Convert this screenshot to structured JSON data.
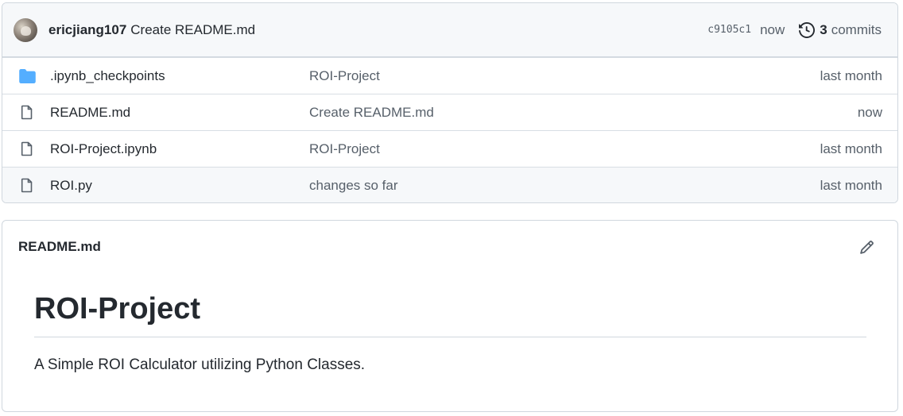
{
  "commit": {
    "author": "ericjiang107",
    "message": "Create README.md",
    "sha": "c9105c1",
    "time": "now",
    "commit_count": "3",
    "commit_label": "commits"
  },
  "files": [
    {
      "type": "folder",
      "icon": "folder-icon",
      "name": ".ipynb_checkpoints",
      "message": "ROI-Project",
      "age": "last month"
    },
    {
      "type": "file",
      "icon": "file-icon",
      "name": "README.md",
      "message": "Create README.md",
      "age": "now"
    },
    {
      "type": "file",
      "icon": "file-icon",
      "name": "ROI-Project.ipynb",
      "message": "ROI-Project",
      "age": "last month"
    },
    {
      "type": "file",
      "icon": "file-icon",
      "name": "ROI.py",
      "message": "changes so far",
      "age": "last month"
    }
  ],
  "readme": {
    "filename": "README.md",
    "heading": "ROI-Project",
    "body": "A Simple ROI Calculator utilizing Python Classes."
  },
  "colors": {
    "folder": "#54aeff",
    "border": "#d0d7de",
    "muted": "#57606a",
    "text": "#24292f"
  }
}
